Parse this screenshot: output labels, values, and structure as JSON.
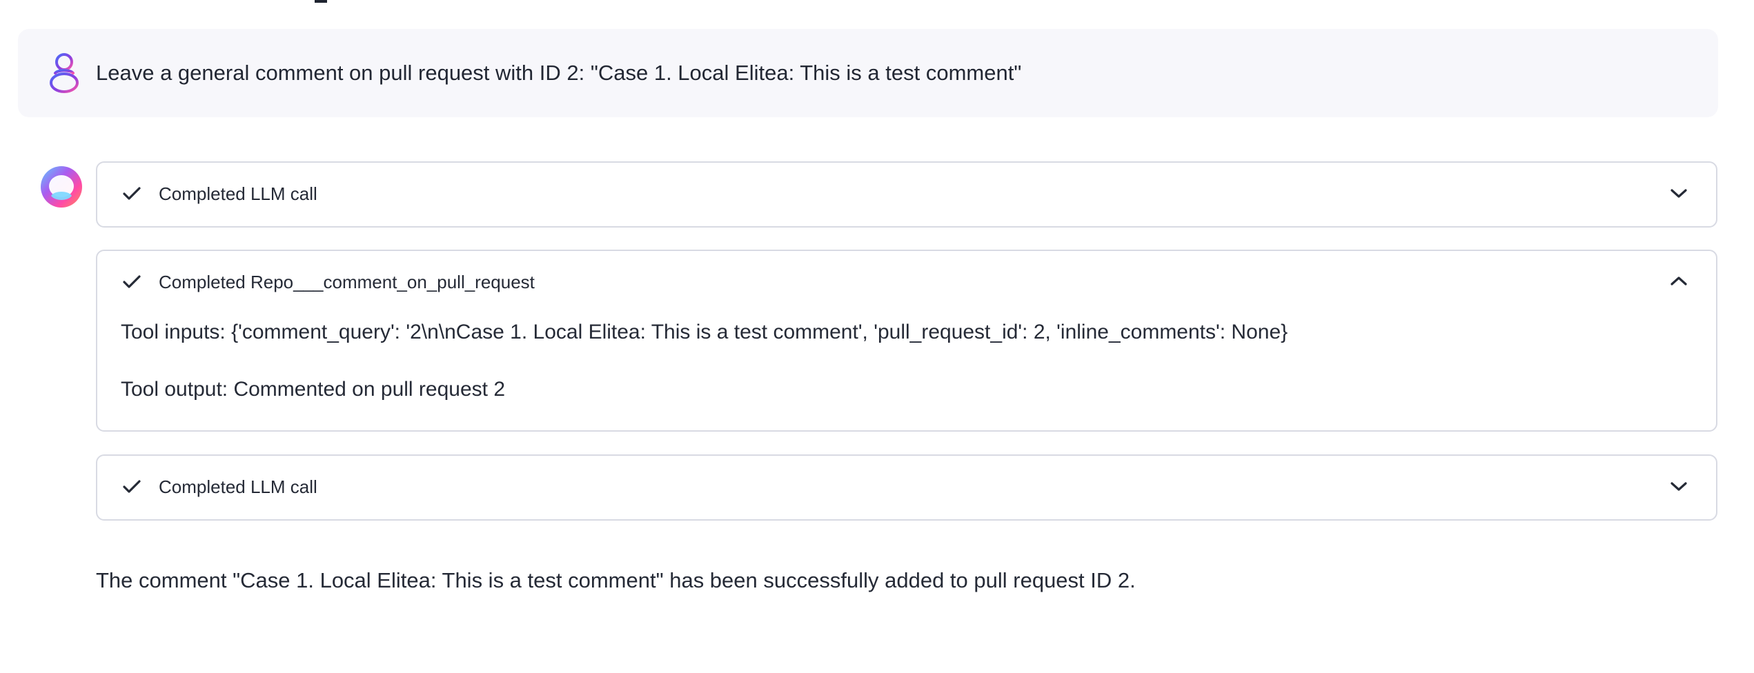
{
  "user_message": {
    "text": "Leave a general comment on pull request with ID 2: \"Case 1. Local Elitea: This is a test comment\"",
    "avatar_icon": "user-avatar-icon"
  },
  "assistant": {
    "avatar_icon": "assistant-avatar-icon",
    "steps": [
      {
        "title": "Completed LLM call",
        "status_icon": "check-icon",
        "toggle_icon": "chevron-down-icon",
        "expanded": false
      },
      {
        "title": "Completed Repo___comment_on_pull_request",
        "status_icon": "check-icon",
        "toggle_icon": "chevron-up-icon",
        "expanded": true,
        "tool_inputs": "Tool inputs: {'comment_query': '2\\n\\nCase 1. Local Elitea: This is a test comment', 'pull_request_id': 2, 'inline_comments': None}",
        "tool_output": "Tool output: Commented on pull request 2"
      },
      {
        "title": "Completed LLM call",
        "status_icon": "check-icon",
        "toggle_icon": "chevron-down-icon",
        "expanded": false
      }
    ],
    "response": "The comment \"Case 1. Local Elitea: This is a test comment\" has been successfully added to pull request ID 2."
  },
  "colors": {
    "user_message_bg": "#f7f7fb",
    "border": "#d8dae3",
    "text": "#252a36",
    "avatar_gradient_start": "#7b3fd8",
    "avatar_gradient_end": "#ff4f9a"
  }
}
